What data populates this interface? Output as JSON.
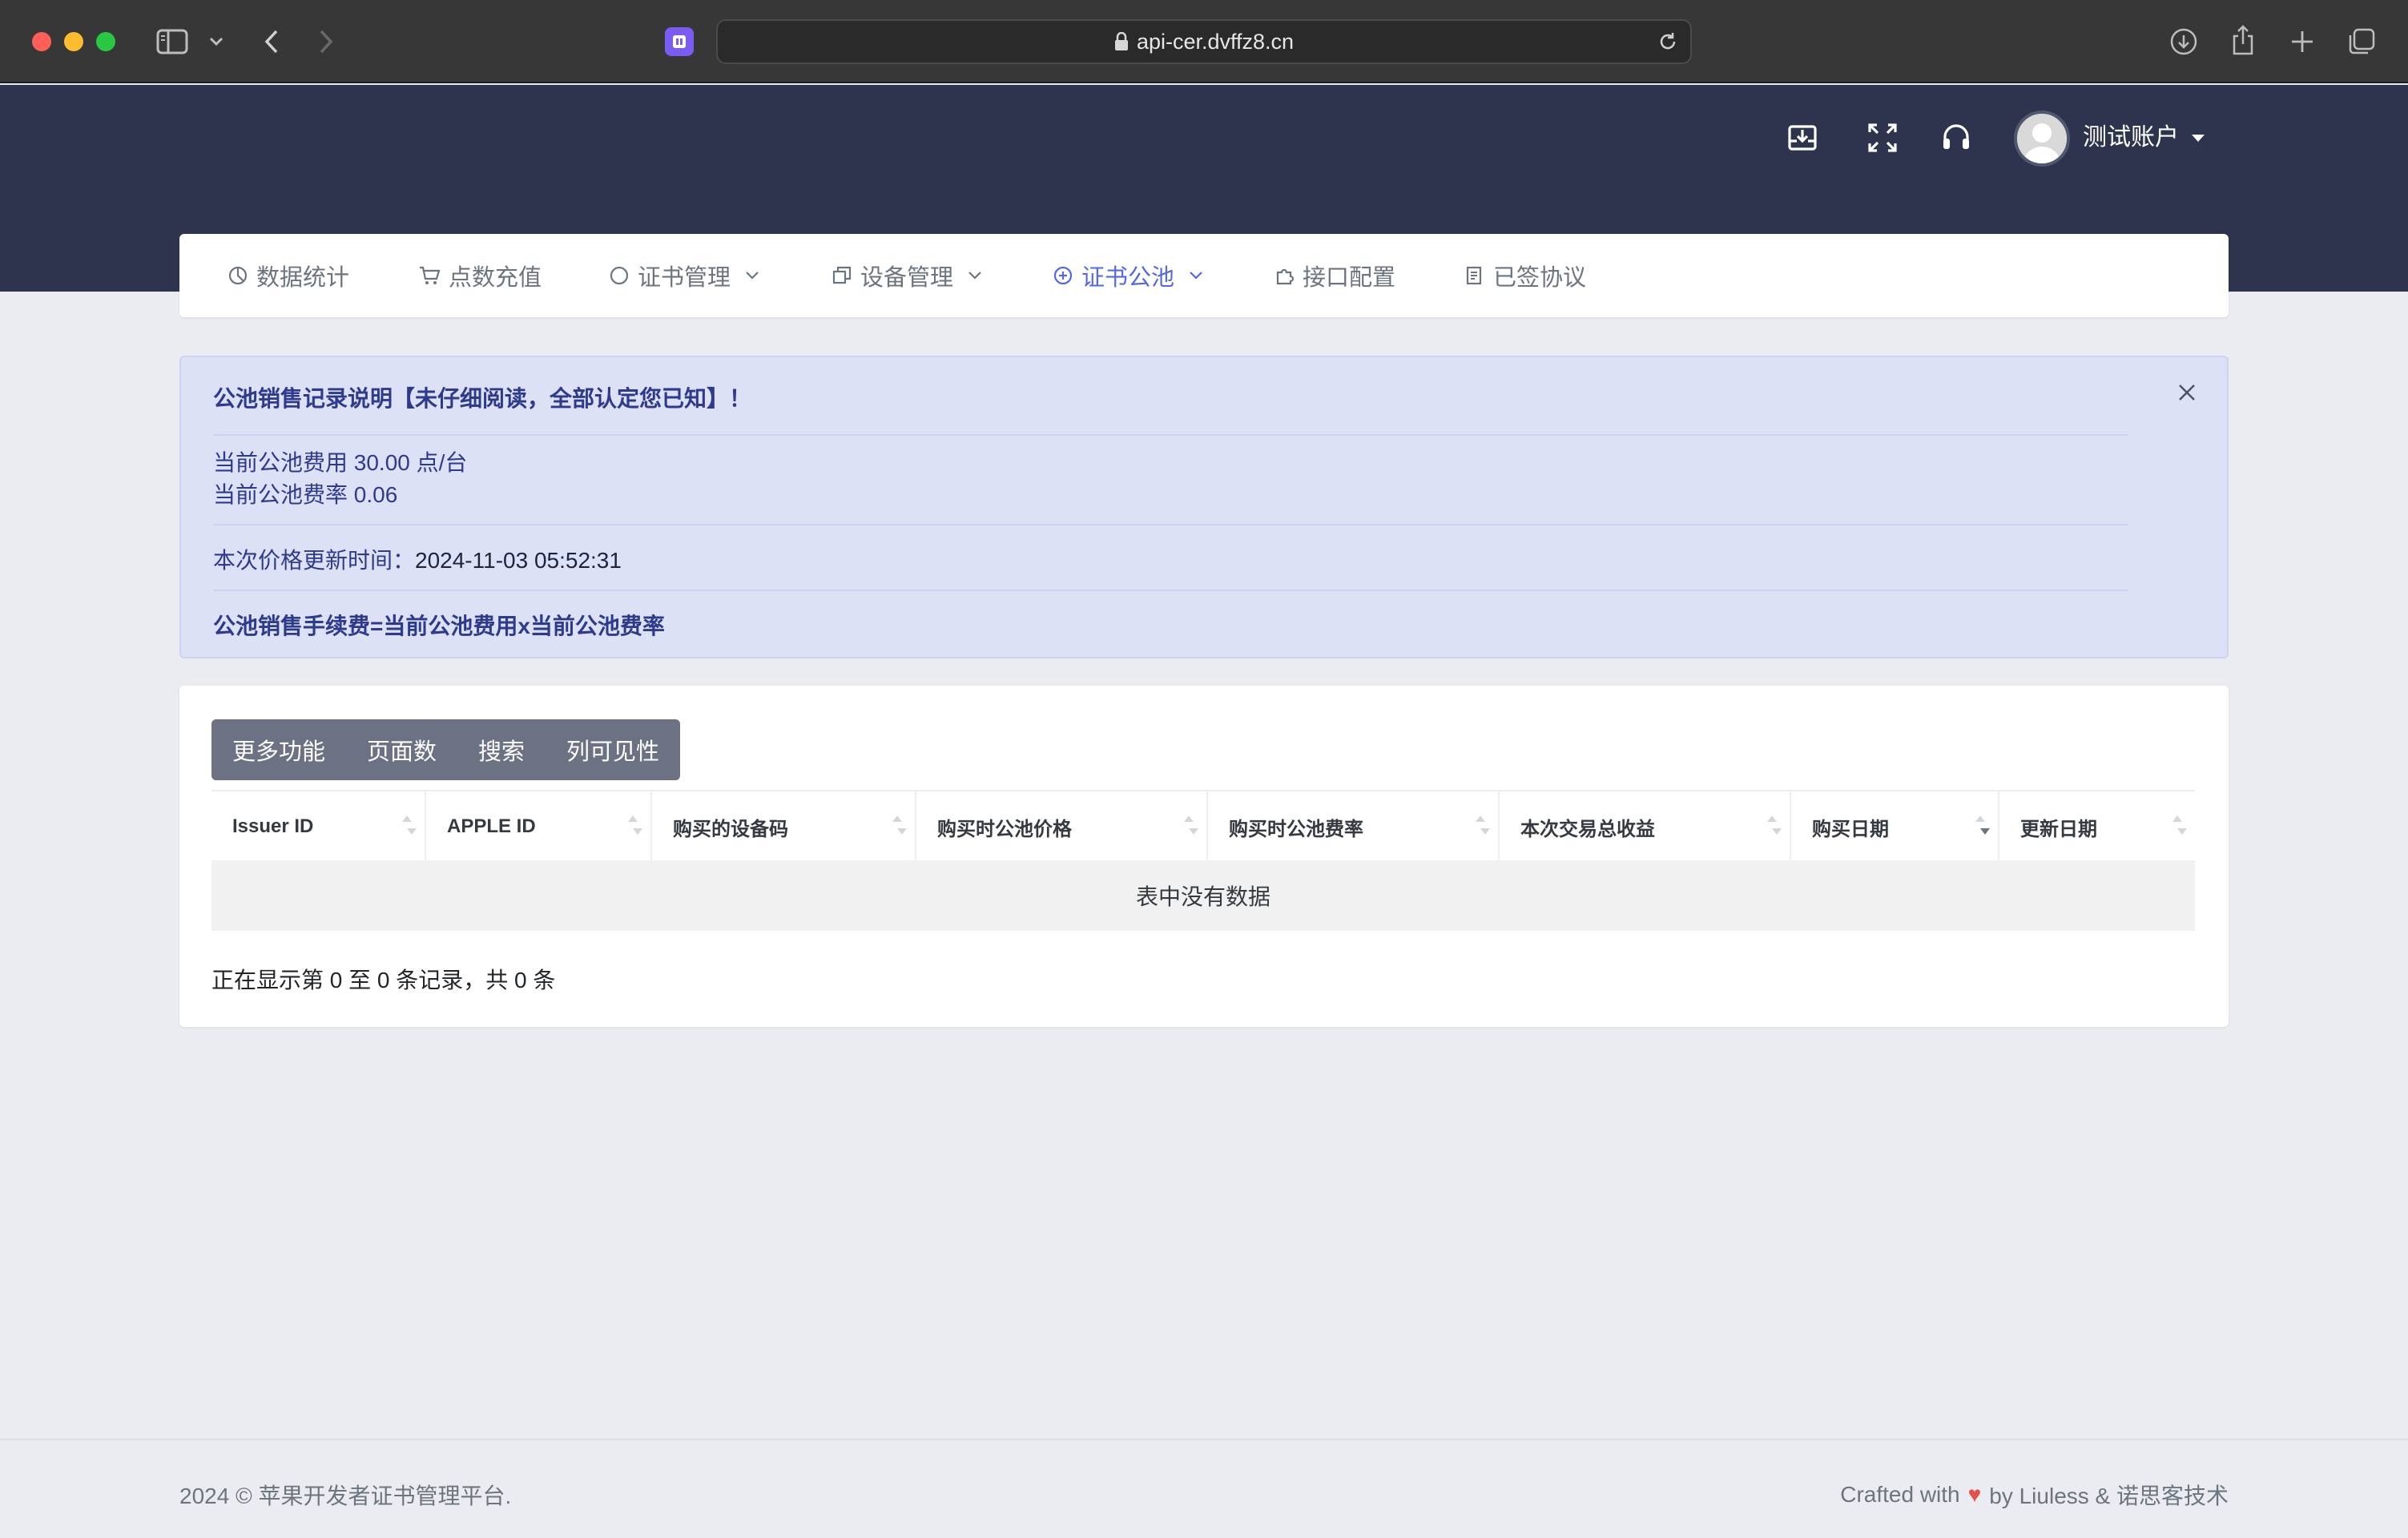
{
  "browser": {
    "url": "api-cer.dvffz8.cn",
    "icons": [
      "sidebar-icon",
      "chevron-down-icon",
      "back-icon",
      "forward-icon",
      "extension-icon",
      "lock-icon",
      "reload-icon",
      "download-icon",
      "share-icon",
      "new-tab-icon",
      "tabs-overview-icon"
    ]
  },
  "header": {
    "icons": [
      "archive-download-icon",
      "fullscreen-icon",
      "headset-icon"
    ],
    "username": "测试账户"
  },
  "nav": {
    "items": [
      {
        "label": "数据统计",
        "icon": "pie-chart-icon",
        "dropdown": false,
        "active": false
      },
      {
        "label": "点数充值",
        "icon": "cart-icon",
        "dropdown": false,
        "active": false
      },
      {
        "label": "证书管理",
        "icon": "circle-icon",
        "dropdown": true,
        "active": false
      },
      {
        "label": "设备管理",
        "icon": "copy-icon",
        "dropdown": true,
        "active": false
      },
      {
        "label": "证书公池",
        "icon": "plus-circle-icon",
        "dropdown": true,
        "active": true
      },
      {
        "label": "接口配置",
        "icon": "puzzle-icon",
        "dropdown": false,
        "active": false
      },
      {
        "label": "已签协议",
        "icon": "document-icon",
        "dropdown": false,
        "active": false
      }
    ]
  },
  "alert": {
    "title": "公池销售记录说明【未仔细阅读，全部认定您已知】！",
    "fee_line": "当前公池费用 30.00 点/台",
    "rate_line": "当前公池费率 0.06",
    "update_label": "本次价格更新时间：",
    "update_value": "2024-11-03 05:52:31",
    "formula": "公池销售手续费=当前公池费用x当前公池费率"
  },
  "toolbar": {
    "buttons": [
      "更多功能",
      "页面数",
      "搜索",
      "列可见性"
    ]
  },
  "table": {
    "columns": [
      "Issuer ID",
      "APPLE ID",
      "购买的设备码",
      "购买时公池价格",
      "购买时公池费率",
      "本次交易总收益",
      "购买日期",
      "更新日期"
    ],
    "sorted_column": "购买日期",
    "sort_direction": "desc",
    "rows": [],
    "empty_text": "表中没有数据",
    "info": "正在显示第 0 至 0 条记录，共 0 条"
  },
  "footer": {
    "copyright": "2024 © 苹果开发者证书管理平台.",
    "crafted_prefix": "Crafted with",
    "heart": "♥",
    "crafted_suffix": "by Liuless & 诺思客技术"
  },
  "colors": {
    "header_bg": "#2e344e",
    "accent": "#5468e4",
    "alert_bg": "#dde1f6",
    "button_bg": "#6c7183",
    "heart": "#e3524a"
  }
}
